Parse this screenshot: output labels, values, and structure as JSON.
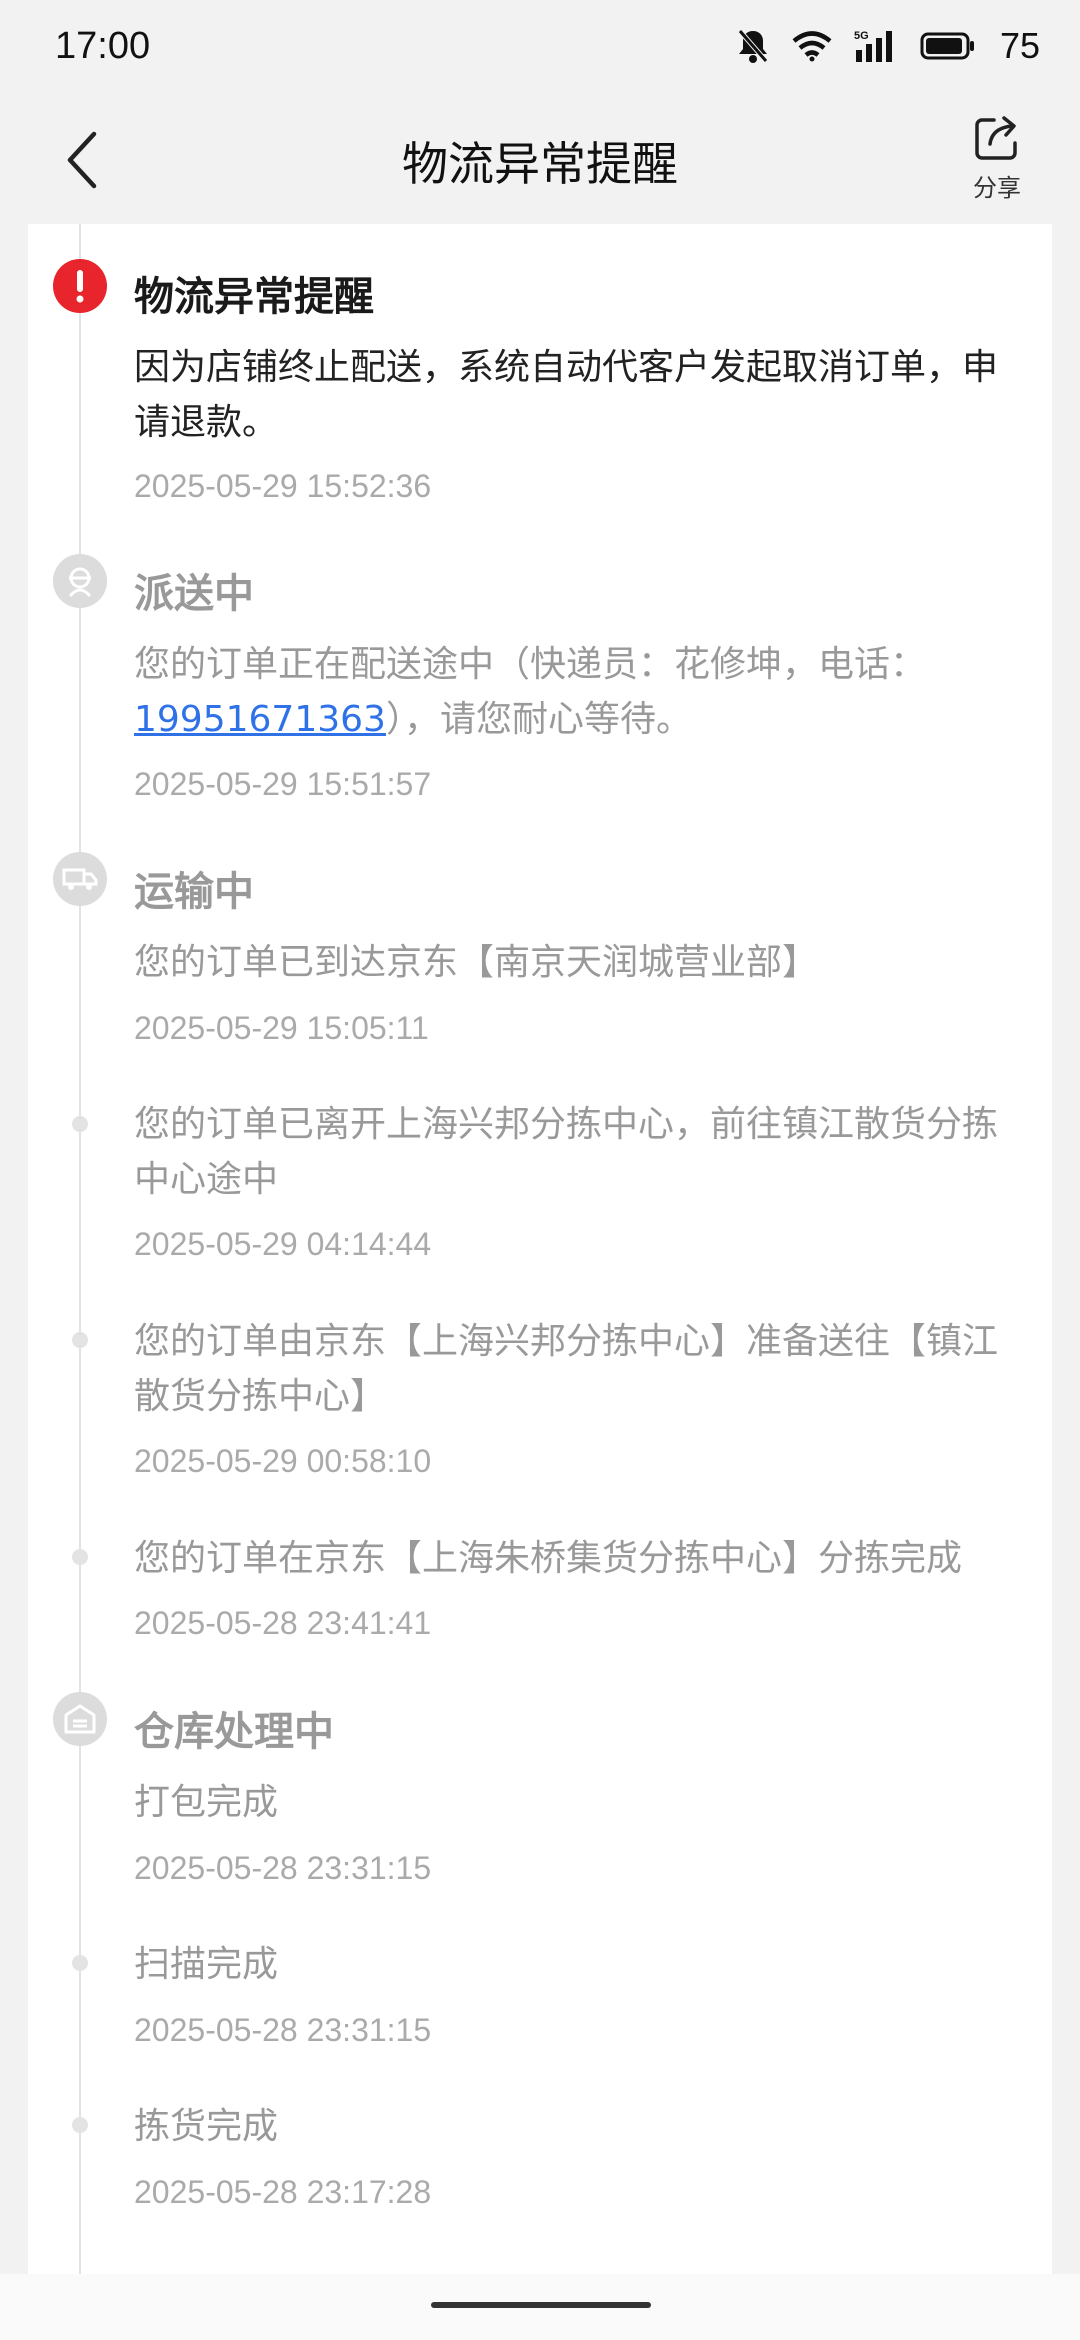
{
  "status_bar": {
    "time": "17:00",
    "battery": "75",
    "icons": [
      "mute-icon",
      "wifi-icon",
      "5g-signal-icon",
      "battery-icon"
    ]
  },
  "header": {
    "title": "物流异常提醒",
    "share_label": "分享"
  },
  "colors": {
    "alert_red": "#e8242c",
    "link_blue": "#2f72e8",
    "inactive_gray": "#999999"
  },
  "timeline": [
    {
      "title": "物流异常提醒",
      "desc": "因为店铺终止配送，系统自动代客户发起取消订单，申请退款。",
      "time": "2025-05-29 15:52:36",
      "icon": "alert-icon"
    },
    {
      "title": "派送中",
      "desc_prefix": "您的订单正在配送途中（快递员：花修坤，电话：",
      "phone": "19951671363",
      "desc_suffix": "），请您耐心等待。",
      "time": "2025-05-29 15:51:57",
      "icon": "courier-icon"
    },
    {
      "title": "运输中",
      "desc": "您的订单已到达京东【南京天润城营业部】",
      "time": "2025-05-29 15:05:11",
      "icon": "truck-icon"
    },
    {
      "desc": "您的订单已离开上海兴邦分拣中心，前往镇江散货分拣中心途中",
      "time": "2025-05-29 04:14:44"
    },
    {
      "desc": "您的订单由京东【上海兴邦分拣中心】准备送往【镇江散货分拣中心】",
      "time": "2025-05-29 00:58:10"
    },
    {
      "desc": "您的订单在京东【上海朱桥集货分拣中心】分拣完成",
      "time": "2025-05-28 23:41:41"
    },
    {
      "title": "仓库处理中",
      "desc": "打包完成",
      "time": "2025-05-28 23:31:15",
      "icon": "warehouse-icon"
    },
    {
      "desc": "扫描完成",
      "time": "2025-05-28 23:31:15"
    },
    {
      "desc": "拣货完成",
      "time": "2025-05-28 23:17:28"
    }
  ]
}
